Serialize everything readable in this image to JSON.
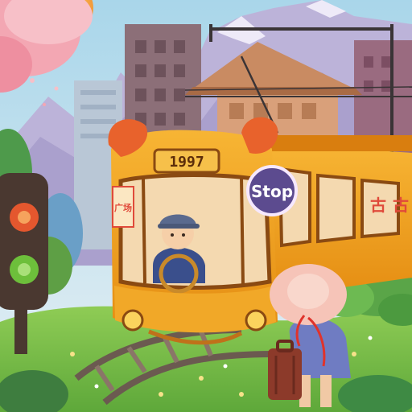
{
  "scene": {
    "tram_number": "1997",
    "stop_sign": "Stop",
    "tram_side_sign": "广场",
    "tram_window_chars": [
      "古",
      "古"
    ]
  },
  "colors": {
    "sky": "#bfe0ee",
    "mountain": "#b9b2d6",
    "tram_body": "#f2a321",
    "tram_window_frame": "#8a4a12",
    "stop_sign_bg": "#5c4b8f",
    "grass": "#7cc04a",
    "traffic_light_red": "#e4572e",
    "traffic_light_green": "#6dbf3b"
  }
}
